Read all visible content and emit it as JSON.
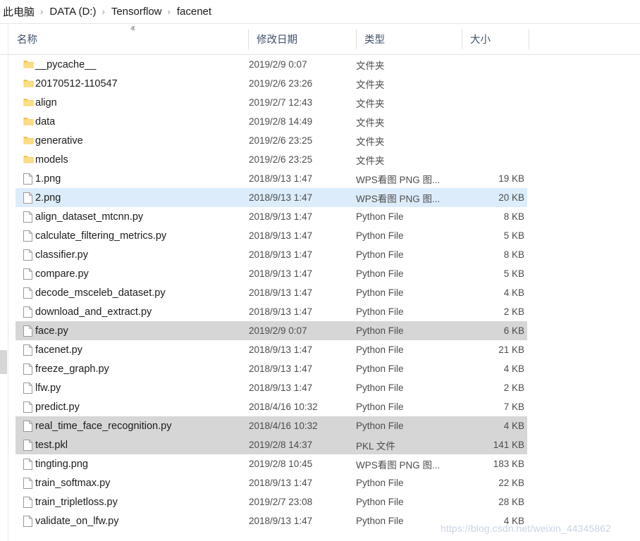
{
  "breadcrumb": {
    "separator": "›",
    "items": [
      {
        "label": "此电脑"
      },
      {
        "label": "DATA (D:)"
      },
      {
        "label": "Tensorflow"
      },
      {
        "label": "facenet"
      }
    ]
  },
  "columns": {
    "name": "名称",
    "date_modified": "修改日期",
    "type": "类型",
    "size": "大小",
    "sort_indicator": "ⱏ"
  },
  "files": [
    {
      "name": "__pycache__",
      "date": "2019/2/9 0:07",
      "type": "文件夹",
      "size": "",
      "icon": "folder-icon",
      "state": "normal"
    },
    {
      "name": "20170512-110547",
      "date": "2019/2/6 23:26",
      "type": "文件夹",
      "size": "",
      "icon": "folder-icon",
      "state": "normal"
    },
    {
      "name": "align",
      "date": "2019/2/7 12:43",
      "type": "文件夹",
      "size": "",
      "icon": "folder-icon",
      "state": "normal"
    },
    {
      "name": "data",
      "date": "2019/2/8 14:49",
      "type": "文件夹",
      "size": "",
      "icon": "folder-icon",
      "state": "normal"
    },
    {
      "name": "generative",
      "date": "2019/2/6 23:25",
      "type": "文件夹",
      "size": "",
      "icon": "folder-icon",
      "state": "normal"
    },
    {
      "name": "models",
      "date": "2019/2/6 23:25",
      "type": "文件夹",
      "size": "",
      "icon": "folder-icon",
      "state": "normal"
    },
    {
      "name": "1.png",
      "date": "2018/9/13 1:47",
      "type": "WPS看图 PNG 图...",
      "size": "19 KB",
      "icon": "file-icon",
      "state": "normal"
    },
    {
      "name": "2.png",
      "date": "2018/9/13 1:47",
      "type": "WPS看图 PNG 图...",
      "size": "20 KB",
      "icon": "file-icon",
      "state": "selected"
    },
    {
      "name": "align_dataset_mtcnn.py",
      "date": "2018/9/13 1:47",
      "type": "Python File",
      "size": "8 KB",
      "icon": "file-icon",
      "state": "normal"
    },
    {
      "name": "calculate_filtering_metrics.py",
      "date": "2018/9/13 1:47",
      "type": "Python File",
      "size": "5 KB",
      "icon": "file-icon",
      "state": "normal"
    },
    {
      "name": "classifier.py",
      "date": "2018/9/13 1:47",
      "type": "Python File",
      "size": "8 KB",
      "icon": "file-icon",
      "state": "normal"
    },
    {
      "name": "compare.py",
      "date": "2018/9/13 1:47",
      "type": "Python File",
      "size": "5 KB",
      "icon": "file-icon",
      "state": "normal"
    },
    {
      "name": "decode_msceleb_dataset.py",
      "date": "2018/9/13 1:47",
      "type": "Python File",
      "size": "4 KB",
      "icon": "file-icon",
      "state": "normal"
    },
    {
      "name": "download_and_extract.py",
      "date": "2018/9/13 1:47",
      "type": "Python File",
      "size": "2 KB",
      "icon": "file-icon",
      "state": "normal"
    },
    {
      "name": "face.py",
      "date": "2019/2/9 0:07",
      "type": "Python File",
      "size": "6 KB",
      "icon": "file-icon",
      "state": "highlight"
    },
    {
      "name": "facenet.py",
      "date": "2018/9/13 1:47",
      "type": "Python File",
      "size": "21 KB",
      "icon": "file-icon",
      "state": "normal"
    },
    {
      "name": "freeze_graph.py",
      "date": "2018/9/13 1:47",
      "type": "Python File",
      "size": "4 KB",
      "icon": "file-icon",
      "state": "normal"
    },
    {
      "name": "lfw.py",
      "date": "2018/9/13 1:47",
      "type": "Python File",
      "size": "2 KB",
      "icon": "file-icon",
      "state": "normal"
    },
    {
      "name": "predict.py",
      "date": "2018/4/16 10:32",
      "type": "Python File",
      "size": "7 KB",
      "icon": "file-icon",
      "state": "normal"
    },
    {
      "name": "real_time_face_recognition.py",
      "date": "2018/4/16 10:32",
      "type": "Python File",
      "size": "4 KB",
      "icon": "file-icon",
      "state": "highlight"
    },
    {
      "name": "test.pkl",
      "date": "2019/2/8 14:37",
      "type": "PKL 文件",
      "size": "141 KB",
      "icon": "file-icon",
      "state": "highlight"
    },
    {
      "name": "tingting.png",
      "date": "2019/2/8 10:45",
      "type": "WPS看图 PNG 图...",
      "size": "183 KB",
      "icon": "file-icon",
      "state": "normal"
    },
    {
      "name": "train_softmax.py",
      "date": "2018/9/13 1:47",
      "type": "Python File",
      "size": "22 KB",
      "icon": "file-icon",
      "state": "normal"
    },
    {
      "name": "train_tripletloss.py",
      "date": "2019/2/7 23:08",
      "type": "Python File",
      "size": "28 KB",
      "icon": "file-icon",
      "state": "normal"
    },
    {
      "name": "validate_on_lfw.py",
      "date": "2018/9/13 1:47",
      "type": "Python File",
      "size": "4 KB",
      "icon": "file-icon",
      "state": "normal"
    }
  ],
  "watermark": {
    "text": "https://blog.csdn.net/weixin_44345862"
  },
  "colors": {
    "selection_blue": "#dcecfa",
    "highlight_gray": "#d6d6d6",
    "header_text": "#40526b",
    "folder_yellow": "#f7d070",
    "watermark": "#c7d4e4"
  }
}
